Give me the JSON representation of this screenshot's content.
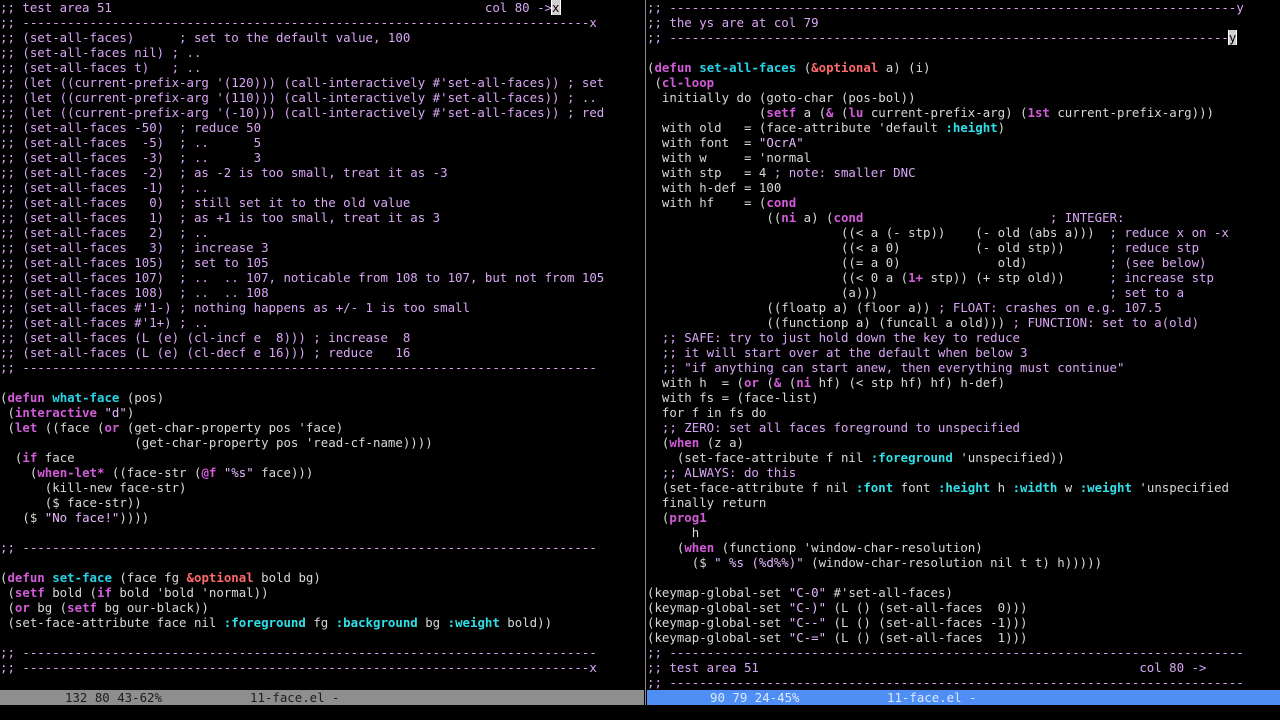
{
  "colors": {
    "comment": "#d9a6f5",
    "keyword": "#d25bd9",
    "function_name": "#27d3e6",
    "builtin": "#ff6a6a",
    "string": "#e6b8ff",
    "constant": "#30e0e8",
    "default": "#d8d8d8",
    "modeline_active_bg": "#4f8ff5",
    "modeline_inactive_bg": "#8e8e8e"
  },
  "left_window": {
    "lines": [
      [
        {
          "t": ";; test area 51                                                  col 80 ->",
          "f": "c"
        },
        {
          "t": "x",
          "f": "cur"
        }
      ],
      [
        {
          "t": ";; ----------------------------------------------------------------------------x",
          "f": "c"
        }
      ],
      [
        {
          "t": ";; (set-all-faces)      ; set to the default value, 100",
          "f": "c"
        }
      ],
      [
        {
          "t": ";; (set-all-faces nil) ; ..",
          "f": "c"
        }
      ],
      [
        {
          "t": ";; (set-all-faces t)   ; ..",
          "f": "c"
        }
      ],
      [
        {
          "t": ";; (let ((current-prefix-arg '(120))) (call-interactively #'set-all-faces)) ; set",
          "f": "c"
        }
      ],
      [
        {
          "t": ";; (let ((current-prefix-arg '(110))) (call-interactively #'set-all-faces)) ; ..",
          "f": "c"
        }
      ],
      [
        {
          "t": ";; (let ((current-prefix-arg '(-10))) (call-interactively #'set-all-faces)) ; red",
          "f": "c"
        }
      ],
      [
        {
          "t": ";; (set-all-faces -50)  ; reduce 50",
          "f": "c"
        }
      ],
      [
        {
          "t": ";; (set-all-faces  -5)  ; ..      5",
          "f": "c"
        }
      ],
      [
        {
          "t": ";; (set-all-faces  -3)  ; ..      3",
          "f": "c"
        }
      ],
      [
        {
          "t": ";; (set-all-faces  -2)  ; as -2 is too small, treat it as -3",
          "f": "c"
        }
      ],
      [
        {
          "t": ";; (set-all-faces  -1)  ; ..",
          "f": "c"
        }
      ],
      [
        {
          "t": ";; (set-all-faces   0)  ; still set it to the old value",
          "f": "c"
        }
      ],
      [
        {
          "t": ";; (set-all-faces   1)  ; as +1 is too small, treat it as 3",
          "f": "c"
        }
      ],
      [
        {
          "t": ";; (set-all-faces   2)  ; ..",
          "f": "c"
        }
      ],
      [
        {
          "t": ";; (set-all-faces   3)  ; increase 3",
          "f": "c"
        }
      ],
      [
        {
          "t": ";; (set-all-faces 105)  ; set to 105",
          "f": "c"
        }
      ],
      [
        {
          "t": ";; (set-all-faces 107)  ; ..  .. 107, noticable from 108 to 107, but not from 105",
          "f": "c"
        }
      ],
      [
        {
          "t": ";; (set-all-faces 108)  ; ..  .. 108",
          "f": "c"
        }
      ],
      [
        {
          "t": ";; (set-all-faces #'1-) ; nothing happens as +/- 1 is too small",
          "f": "c"
        }
      ],
      [
        {
          "t": ";; (set-all-faces #'1+) ; ..",
          "f": "c"
        }
      ],
      [
        {
          "t": ";; (set-all-faces (L (e) (cl-incf e  8))) ; increase  8",
          "f": "c"
        }
      ],
      [
        {
          "t": ";; (set-all-faces (L (e) (cl-decf e 16))) ; reduce   16",
          "f": "c"
        }
      ],
      [
        {
          "t": ";; -----------------------------------------------------------------------------",
          "f": "c"
        }
      ],
      [
        {
          "t": "",
          "f": "d"
        }
      ],
      [
        {
          "t": "(",
          "f": "d"
        },
        {
          "t": "defun",
          "f": "k"
        },
        {
          "t": " ",
          "f": "d"
        },
        {
          "t": "what-face",
          "f": "fn"
        },
        {
          "t": " (pos)",
          "f": "d"
        }
      ],
      [
        {
          "t": " (",
          "f": "d"
        },
        {
          "t": "interactive",
          "f": "k"
        },
        {
          "t": " ",
          "f": "d"
        },
        {
          "t": "\"d\"",
          "f": "s"
        },
        {
          "t": ")",
          "f": "d"
        }
      ],
      [
        {
          "t": " (",
          "f": "d"
        },
        {
          "t": "let",
          "f": "k"
        },
        {
          "t": " ((face (",
          "f": "d"
        },
        {
          "t": "or",
          "f": "k"
        },
        {
          "t": " (get-char-property pos 'face)",
          "f": "d"
        }
      ],
      [
        {
          "t": "                  (get-char-property pos 'read-cf-name))))",
          "f": "d"
        }
      ],
      [
        {
          "t": "  (",
          "f": "d"
        },
        {
          "t": "if",
          "f": "k"
        },
        {
          "t": " face",
          "f": "d"
        }
      ],
      [
        {
          "t": "    (",
          "f": "d"
        },
        {
          "t": "when-let*",
          "f": "k"
        },
        {
          "t": " ((face-str (",
          "f": "d"
        },
        {
          "t": "@f",
          "f": "k"
        },
        {
          "t": " ",
          "f": "d"
        },
        {
          "t": "\"%s\"",
          "f": "s"
        },
        {
          "t": " face)))",
          "f": "d"
        }
      ],
      [
        {
          "t": "      (kill-new face-str)",
          "f": "d"
        }
      ],
      [
        {
          "t": "      ($ face-str))",
          "f": "d"
        }
      ],
      [
        {
          "t": "   ($ ",
          "f": "d"
        },
        {
          "t": "\"No face!\"",
          "f": "s"
        },
        {
          "t": "))))",
          "f": "d"
        }
      ],
      [
        {
          "t": "",
          "f": "d"
        }
      ],
      [
        {
          "t": ";; -----------------------------------------------------------------------------",
          "f": "c"
        }
      ],
      [
        {
          "t": "",
          "f": "d"
        }
      ],
      [
        {
          "t": "(",
          "f": "d"
        },
        {
          "t": "defun",
          "f": "k"
        },
        {
          "t": " ",
          "f": "d"
        },
        {
          "t": "set-face",
          "f": "fn"
        },
        {
          "t": " (face fg ",
          "f": "d"
        },
        {
          "t": "&optional",
          "f": "b"
        },
        {
          "t": " bold bg)",
          "f": "d"
        }
      ],
      [
        {
          "t": " (",
          "f": "d"
        },
        {
          "t": "setf",
          "f": "k"
        },
        {
          "t": " bold (",
          "f": "d"
        },
        {
          "t": "if",
          "f": "k"
        },
        {
          "t": " bold 'bold 'normal))",
          "f": "d"
        }
      ],
      [
        {
          "t": " (",
          "f": "d"
        },
        {
          "t": "or",
          "f": "k"
        },
        {
          "t": " bg (",
          "f": "d"
        },
        {
          "t": "setf",
          "f": "k"
        },
        {
          "t": " bg our-black))",
          "f": "d"
        }
      ],
      [
        {
          "t": " (set-face-attribute face nil ",
          "f": "d"
        },
        {
          "t": ":foreground",
          "f": "ct"
        },
        {
          "t": " fg ",
          "f": "d"
        },
        {
          "t": ":background",
          "f": "ct"
        },
        {
          "t": " bg ",
          "f": "d"
        },
        {
          "t": ":weight",
          "f": "ct"
        },
        {
          "t": " bold))",
          "f": "d"
        }
      ],
      [
        {
          "t": "",
          "f": "d"
        }
      ],
      [
        {
          "t": ";; -----------------------------------------------------------------------------",
          "f": "c"
        }
      ],
      [
        {
          "t": ";; ----------------------------------------------------------------------------x",
          "f": "c"
        }
      ]
    ]
  },
  "right_window": {
    "lines": [
      [
        {
          "t": ";; ----------------------------------------------------------------------------y",
          "f": "c"
        }
      ],
      [
        {
          "t": ";; the ys are at col 79",
          "f": "c"
        }
      ],
      [
        {
          "t": ";; ---------------------------------------------------------------------------",
          "f": "c"
        },
        {
          "t": "y",
          "f": "cur"
        }
      ],
      [
        {
          "t": "",
          "f": "d"
        }
      ],
      [
        {
          "t": "(",
          "f": "d"
        },
        {
          "t": "defun",
          "f": "k"
        },
        {
          "t": " ",
          "f": "d"
        },
        {
          "t": "set-all-faces",
          "f": "fn"
        },
        {
          "t": " (",
          "f": "d"
        },
        {
          "t": "&optional",
          "f": "b"
        },
        {
          "t": " a) (i)",
          "f": "d"
        }
      ],
      [
        {
          "t": " (",
          "f": "d"
        },
        {
          "t": "cl-loop",
          "f": "k"
        }
      ],
      [
        {
          "t": "  initially do (goto-char (pos-bol))",
          "f": "d"
        }
      ],
      [
        {
          "t": "               (",
          "f": "d"
        },
        {
          "t": "setf",
          "f": "k"
        },
        {
          "t": " a (",
          "f": "d"
        },
        {
          "t": "&",
          "f": "k"
        },
        {
          "t": " (",
          "f": "d"
        },
        {
          "t": "lu",
          "f": "k"
        },
        {
          "t": " current-prefix-arg) (",
          "f": "d"
        },
        {
          "t": "1st",
          "f": "k"
        },
        {
          "t": " current-prefix-arg)))",
          "f": "d"
        }
      ],
      [
        {
          "t": "  with old   = (face-attribute 'default ",
          "f": "d"
        },
        {
          "t": ":height",
          "f": "ct"
        },
        {
          "t": ")",
          "f": "d"
        }
      ],
      [
        {
          "t": "  with font  = ",
          "f": "d"
        },
        {
          "t": "\"OcrA\"",
          "f": "s"
        }
      ],
      [
        {
          "t": "  with w     = 'normal",
          "f": "d"
        }
      ],
      [
        {
          "t": "  with stp   = 4 ",
          "f": "d"
        },
        {
          "t": "; note: smaller DNC",
          "f": "c"
        }
      ],
      [
        {
          "t": "  with h-def = 100",
          "f": "d"
        }
      ],
      [
        {
          "t": "  with hf    = (",
          "f": "d"
        },
        {
          "t": "cond",
          "f": "k"
        }
      ],
      [
        {
          "t": "                ((",
          "f": "d"
        },
        {
          "t": "ni",
          "f": "k"
        },
        {
          "t": " a) (",
          "f": "d"
        },
        {
          "t": "cond",
          "f": "k"
        },
        {
          "t": "                         ",
          "f": "d"
        },
        {
          "t": "; INTEGER:",
          "f": "c"
        }
      ],
      [
        {
          "t": "                          ((< a (- stp))    (- old (abs a)))  ",
          "f": "d"
        },
        {
          "t": "; reduce x on -x",
          "f": "c"
        }
      ],
      [
        {
          "t": "                          ((< a 0)          (- old stp))      ",
          "f": "d"
        },
        {
          "t": "; reduce stp",
          "f": "c"
        }
      ],
      [
        {
          "t": "                          ((= a 0)             old)           ",
          "f": "d"
        },
        {
          "t": "; (see below)",
          "f": "c"
        }
      ],
      [
        {
          "t": "                          ((< 0 a (",
          "f": "d"
        },
        {
          "t": "1+",
          "f": "k"
        },
        {
          "t": " stp)) (+ stp old))      ",
          "f": "d"
        },
        {
          "t": "; increase stp",
          "f": "c"
        }
      ],
      [
        {
          "t": "                          (a)))                               ",
          "f": "d"
        },
        {
          "t": "; set to a",
          "f": "c"
        }
      ],
      [
        {
          "t": "                ((floatp a) (floor a)) ",
          "f": "d"
        },
        {
          "t": "; FLOAT: crashes on e.g. 107.5",
          "f": "c"
        }
      ],
      [
        {
          "t": "                ((functionp a) (funcall a old))) ",
          "f": "d"
        },
        {
          "t": "; FUNCTION: set to a(old)",
          "f": "c"
        }
      ],
      [
        {
          "t": "  ;; SAFE: try to just hold down the key to reduce",
          "f": "c"
        }
      ],
      [
        {
          "t": "  ;; it will start over at the default when below 3",
          "f": "c"
        }
      ],
      [
        {
          "t": "  ;; \"if anything can start anew, then everything must continue\"",
          "f": "c"
        }
      ],
      [
        {
          "t": "  with h  = (",
          "f": "d"
        },
        {
          "t": "or",
          "f": "k"
        },
        {
          "t": " (",
          "f": "d"
        },
        {
          "t": "&",
          "f": "k"
        },
        {
          "t": " (",
          "f": "d"
        },
        {
          "t": "ni",
          "f": "k"
        },
        {
          "t": " hf) (< stp hf) hf) h-def)",
          "f": "d"
        }
      ],
      [
        {
          "t": "  with fs = (face-list)",
          "f": "d"
        }
      ],
      [
        {
          "t": "  for f in fs do",
          "f": "d"
        }
      ],
      [
        {
          "t": "  ;; ZERO: set all faces foreground to unspecified",
          "f": "c"
        }
      ],
      [
        {
          "t": "  (",
          "f": "d"
        },
        {
          "t": "when",
          "f": "k"
        },
        {
          "t": " (z a)",
          "f": "d"
        }
      ],
      [
        {
          "t": "    (set-face-attribute f nil ",
          "f": "d"
        },
        {
          "t": ":foreground",
          "f": "ct"
        },
        {
          "t": " 'unspecified))",
          "f": "d"
        }
      ],
      [
        {
          "t": "  ;; ALWAYS: do this",
          "f": "c"
        }
      ],
      [
        {
          "t": "  (set-face-attribute f nil ",
          "f": "d"
        },
        {
          "t": ":font",
          "f": "ct"
        },
        {
          "t": " font ",
          "f": "d"
        },
        {
          "t": ":height",
          "f": "ct"
        },
        {
          "t": " h ",
          "f": "d"
        },
        {
          "t": ":width",
          "f": "ct"
        },
        {
          "t": " w ",
          "f": "d"
        },
        {
          "t": ":weight",
          "f": "ct"
        },
        {
          "t": " 'unspecified",
          "f": "d"
        }
      ],
      [
        {
          "t": "  finally return",
          "f": "d"
        }
      ],
      [
        {
          "t": "  (",
          "f": "d"
        },
        {
          "t": "prog1",
          "f": "k"
        }
      ],
      [
        {
          "t": "      h",
          "f": "d"
        }
      ],
      [
        {
          "t": "    (",
          "f": "d"
        },
        {
          "t": "when",
          "f": "k"
        },
        {
          "t": " (functionp 'window-char-resolution)",
          "f": "d"
        }
      ],
      [
        {
          "t": "      ($ ",
          "f": "d"
        },
        {
          "t": "\" %s (%d%%)\"",
          "f": "s"
        },
        {
          "t": " (window-char-resolution nil t t) h)))))",
          "f": "d"
        }
      ],
      [
        {
          "t": "",
          "f": "d"
        }
      ],
      [
        {
          "t": "(keymap-global-set ",
          "f": "d"
        },
        {
          "t": "\"C-0\"",
          "f": "s"
        },
        {
          "t": " #'set-all-faces)",
          "f": "d"
        }
      ],
      [
        {
          "t": "(keymap-global-set ",
          "f": "d"
        },
        {
          "t": "\"C-)\"",
          "f": "s"
        },
        {
          "t": " (L () (set-all-faces  0)))",
          "f": "d"
        }
      ],
      [
        {
          "t": "(keymap-global-set ",
          "f": "d"
        },
        {
          "t": "\"C--\"",
          "f": "s"
        },
        {
          "t": " (L () (set-all-faces -1)))",
          "f": "d"
        }
      ],
      [
        {
          "t": "(keymap-global-set ",
          "f": "d"
        },
        {
          "t": "\"C-=\"",
          "f": "s"
        },
        {
          "t": " (L () (set-all-faces  1)))",
          "f": "d"
        }
      ],
      [
        {
          "t": ";; -----------------------------------------------------------------------------",
          "f": "c"
        }
      ],
      [
        {
          "t": ";; test area 51                                                   col 80 ->",
          "f": "c"
        }
      ],
      [
        {
          "t": ";; -----------------------------------------------------------------------------",
          "f": "c"
        }
      ]
    ]
  },
  "modeline_left": {
    "position": "132 80 43-62%",
    "buffer": "11-face.el -"
  },
  "modeline_right": {
    "position": "90 79 24-45%",
    "buffer": "11-face.el -"
  }
}
